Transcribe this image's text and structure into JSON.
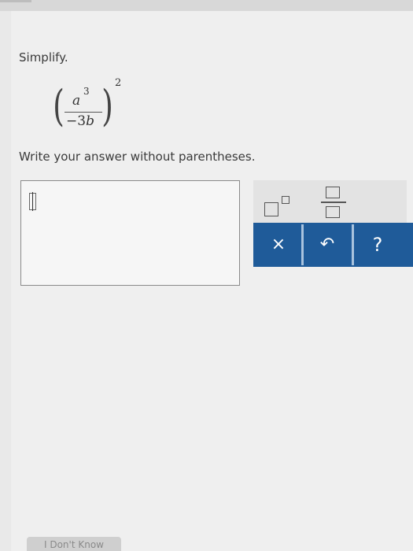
{
  "question": {
    "prompt": "Simplify.",
    "expression": {
      "numerator_base": "a",
      "numerator_exponent": "3",
      "denominator_sign": "−",
      "denominator_coefficient": "3",
      "denominator_variable": "b",
      "outer_exponent": "2"
    },
    "instruction": "Write your answer without parentheses."
  },
  "answer": {
    "value": ""
  },
  "palette": {
    "superscript_icon": "superscript-template-icon",
    "fraction_icon": "fraction-template-icon",
    "clear_label": "×",
    "undo_label": "↶",
    "help_label": "?",
    "accent_color": "#1f5b99"
  },
  "footer": {
    "dont_know_label": "I Don't Know"
  }
}
